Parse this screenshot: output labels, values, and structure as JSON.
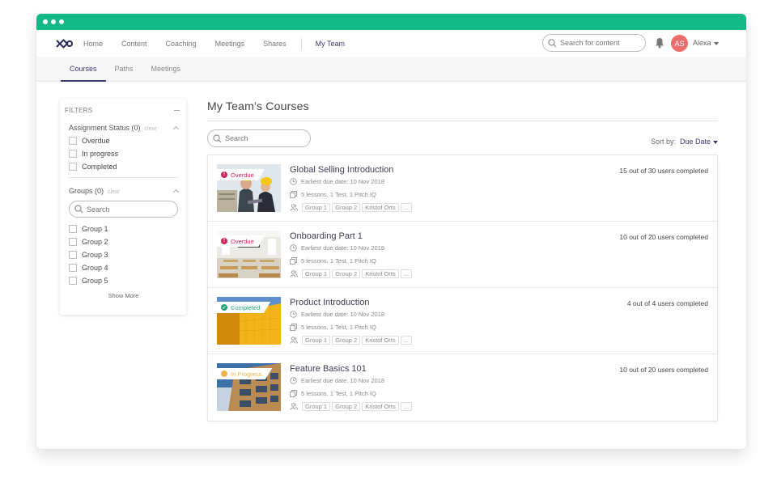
{
  "nav": {
    "logo": "infinity-logo",
    "items": [
      "Home",
      "Content",
      "Coaching",
      "Meetings",
      "Shares"
    ],
    "active_item": "My Team",
    "search_placeholder": "Search for content",
    "user_initials": "AS",
    "user_name": "Alexa",
    "avatar_color": "#ee6c6c"
  },
  "subnav": {
    "tabs": [
      "Courses",
      "Paths",
      "Meetings"
    ],
    "active": "Courses"
  },
  "filters": {
    "title": "FILTERS",
    "assignment": {
      "title": "Assignment Status (0)",
      "clear": "clear",
      "options": [
        "Overdue",
        "In progress",
        "Completed"
      ]
    },
    "groups": {
      "title": "Groups (0)",
      "clear": "clear",
      "search_placeholder": "Search",
      "options": [
        "Group 1",
        "Group 2",
        "Group 3",
        "Group 4",
        "Group 5"
      ],
      "show_more": "Show More"
    }
  },
  "main": {
    "title": "My Team’s Courses",
    "search_placeholder": "Search",
    "sort_label": "Sort by:",
    "sort_value": "Due Date",
    "courses": [
      {
        "title": "Global Selling Introduction",
        "status": "Overdue",
        "due": "Earliest due date: 10 Nov 2018",
        "content": "5 lessons, 1 Test, 1 Pitch IQ",
        "tags": [
          "Group 1",
          "Group 2",
          "Kristof Orts",
          "..."
        ],
        "completion": "15 out of 30 users completed"
      },
      {
        "title": "Onboarding Part 1",
        "status": "Overdue",
        "due": "Earliest due date: 10 Nov 2018",
        "content": "5 lessons, 1 Test, 1 Pitch IQ",
        "tags": [
          "Group 1",
          "Group 2",
          "Kristof Orts",
          "..."
        ],
        "completion": "10 out of 20 users completed"
      },
      {
        "title": "Product Introduction",
        "status": "Completed",
        "due": "Earliest due date: 10 Nov 2018",
        "content": "5 lessons, 1 Test, 1 Pitch IQ",
        "tags": [
          "Group 1",
          "Group 2",
          "Kristof Orts",
          "..."
        ],
        "completion": "4 out of 4 users completed"
      },
      {
        "title": "Feature Basics 101",
        "status": "In Progress",
        "due": "Earliest due date: 10 Nov 2018",
        "content": "5 lessons, 1 Test, 1 Pitch IQ",
        "tags": [
          "Group 1",
          "Group 2",
          "Kristof Orts",
          "..."
        ],
        "completion": "10 out of 20 users completed"
      }
    ]
  },
  "colors": {
    "titlebar": "#13b889",
    "accent": "#3a3a6e",
    "overdue": "#d0245a",
    "completed": "#22a67a",
    "in_progress": "#f0b24a"
  }
}
